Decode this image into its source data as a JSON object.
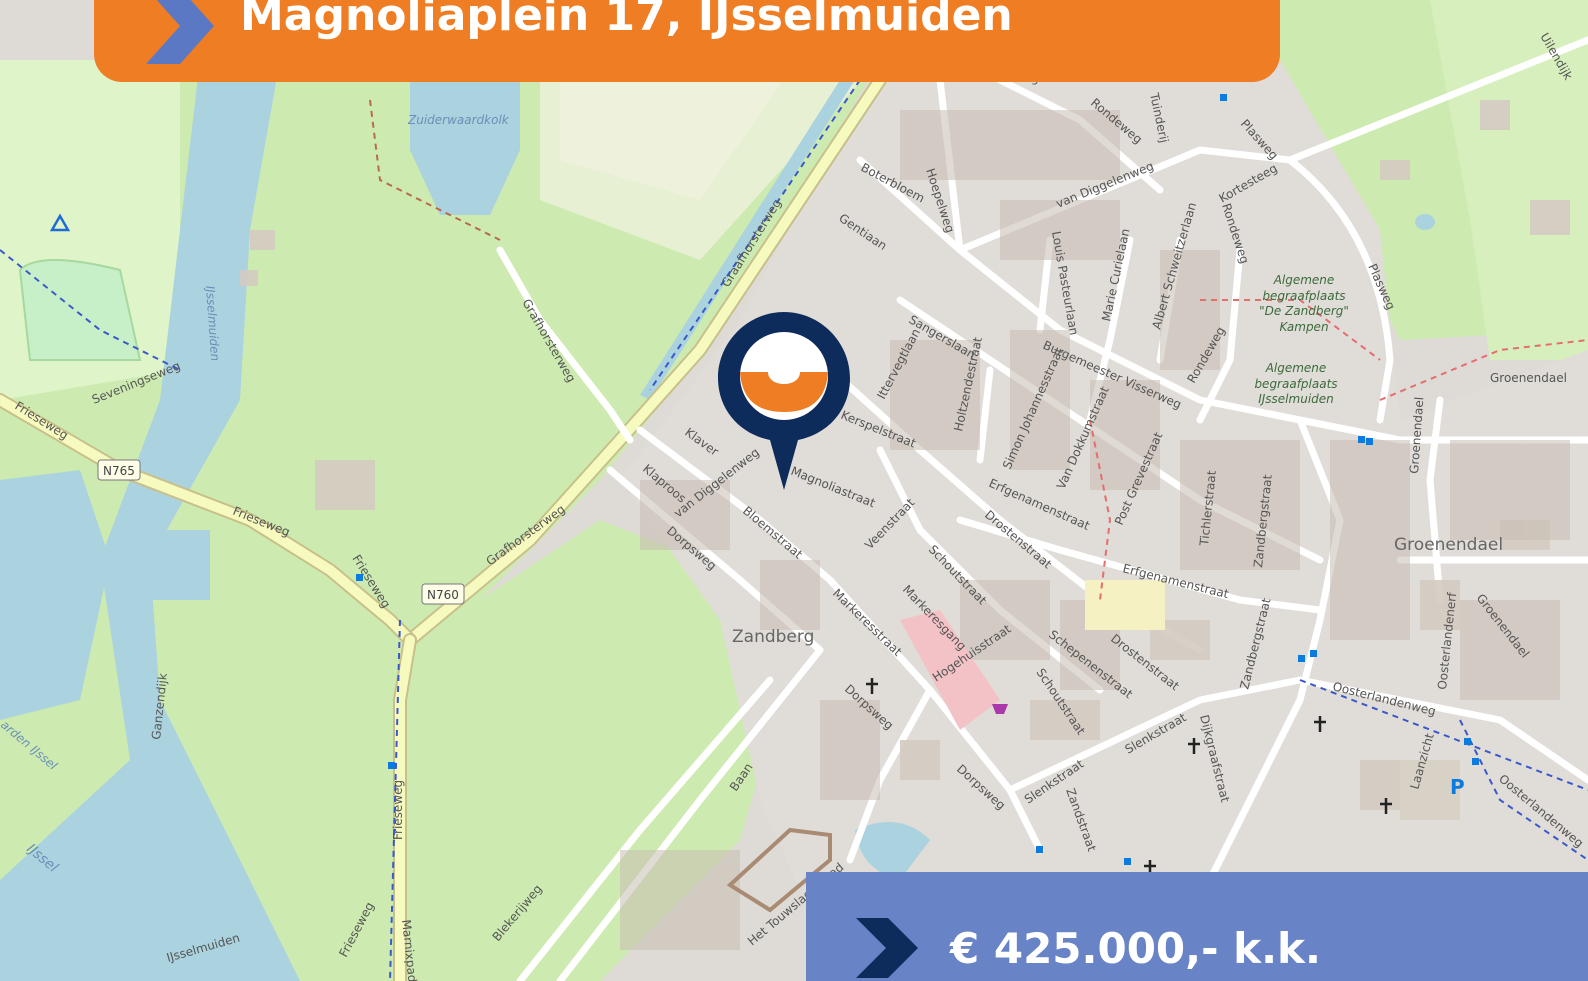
{
  "header": {
    "address": "Magnoliaplein 17, IJsselmuiden"
  },
  "price": {
    "label": "€ 425.000,- k.k."
  },
  "colors": {
    "accent_orange": "#ee7d23",
    "navy": "#0d2b5b",
    "price_blue": "#6883c6",
    "chevron_blue": "#5b78c4"
  },
  "map": {
    "roads": {
      "graafhorsterweg_top": "Graafhorsterweg",
      "graafhorsterweg_bottom": "Grafhorsterweg",
      "graafhorsterweg_path": "Grafhorsterweg",
      "frieseweg_1": "Frieseweg",
      "frieseweg_2": "Frieseweg",
      "frieseweg_3": "Frieseweg",
      "frieseweg_4": "Frieseweg",
      "frieseweg_5": "Frieseweg",
      "seveningseweg": "Seveningseweg",
      "n765": "N765",
      "n760": "N760",
      "rondeweg_1": "Rondeweg",
      "rondeweg_2": "Rondeweg",
      "rondeweg_3": "Rondeweg",
      "rondeweg_4": "Rondeweg",
      "plasweg_1": "Plasweg",
      "plasweg_2": "Plasweg",
      "tuinderij": "Tuinderij",
      "kortesteeg": "Kortesteeg",
      "boterbloem": "Boterbloem",
      "hoepelweg": "Hoepelweg",
      "gentiaan": "Gentiaan",
      "van_diggelenweg_1": "van Diggelenweg",
      "van_diggelenweg_2": "van Diggelenweg",
      "sangerslaan": "Sangerslaan",
      "louis_pasteurlaan": "Louis Pasteurlaan",
      "marie_curielaan": "Marie Curielaan",
      "albert_schweitzerlaan": "Albert Schweitzerlaan",
      "burgemeester_visserweg": "Burgemeester Visserweg",
      "ittervegtlaan": "Ittervegtlaan",
      "holtzendestraat": "Holtzendestraat",
      "simon_johannesstraat": "Simon Johannesstraat",
      "van_dokkumstraat": "Van Dokkumstraat",
      "post_grevestraat": "Post Grevestraat",
      "tichlerstraat": "Tichlerstraat",
      "zandbergstraat_1": "Zandbergstraat",
      "zandbergstraat_2": "Zandbergstraat",
      "zandbergstraat_3": "Zandbergstraat",
      "erfgenamenstraat_1": "Erfgenamenstraat",
      "erfgenamenstraat_2": "Erfgenamenstraat",
      "drostenstraat_1": "Drostenstraat",
      "drostenstraat_2": "Drostenstraat",
      "klaver": "Klaver",
      "klaproos": "Klaproos",
      "magnoliastraat": "Magnoliastraat",
      "kerspelstraat": "Kerspelstraat",
      "bloemstraat": "Bloemstraat",
      "dorpsweg_1": "Dorpsweg",
      "dorpsweg_2": "Dorpsweg",
      "dorpsweg_3": "Dorpsweg",
      "veenstraat": "Veenstraat",
      "schoutstraat_1": "Schoutstraat",
      "schoutstraat_2": "Schoutstraat",
      "markeresstraat": "Markeresstraat",
      "markeresgang": "Markeresgang",
      "hogehuisstraat": "Hogehuisstraat",
      "schepenenstraat": "Schepenenstraat",
      "slenkstraat_1": "Slenkstraat",
      "slenkstraat_2": "Slenkstraat",
      "zandstraat": "Zandstraat",
      "dijkgraafstraat": "Dijkgraafstraat",
      "oosterlandenweg_1": "Oosterlandenweg",
      "oosterlandenweg_2": "Oosterlandenweg",
      "groenendael_1": "Groenendael",
      "groenendael_2": "Groenendael",
      "groenendael_3": "Groenendael",
      "oosterlandenerf": "Oosterlandenerf",
      "laanzicht": "Laanzicht",
      "baan": "Baan",
      "blekerijweg": "Blekerijweg",
      "het_touwslagerspad": "Het Touwslagerspad",
      "ijsselmuiden_road": "IJsselmuiden",
      "marnixpad": "Marnixpad",
      "ganzendijk": "Ganzendijk",
      "uilendijk": "Uilendijk"
    },
    "water": {
      "zuiderwaardkolk": "Zuiderwaardkolk",
      "ijsselmuiden_river": "IJsselmuiden",
      "ijssel": "IJssel",
      "garden_ijssel": "arden IJssel"
    },
    "places": {
      "zandberg": "Zandberg",
      "groenendael": "Groenendael"
    },
    "cemeteries": {
      "zandberg_line1": "Algemene",
      "zandberg_line2": "begraafplaats",
      "zandberg_line3": "\"De Zandberg\"",
      "zandberg_line4": "Kampen",
      "ijsselmuiden_line1": "Algemene",
      "ijsselmuiden_line2": "begraafplaats",
      "ijsselmuiden_line3": "IJsselmuiden"
    },
    "icons": {
      "parking": "P",
      "church": "church-icon",
      "shop": "shopping-basket-icon",
      "camping": "camping-icon"
    }
  }
}
